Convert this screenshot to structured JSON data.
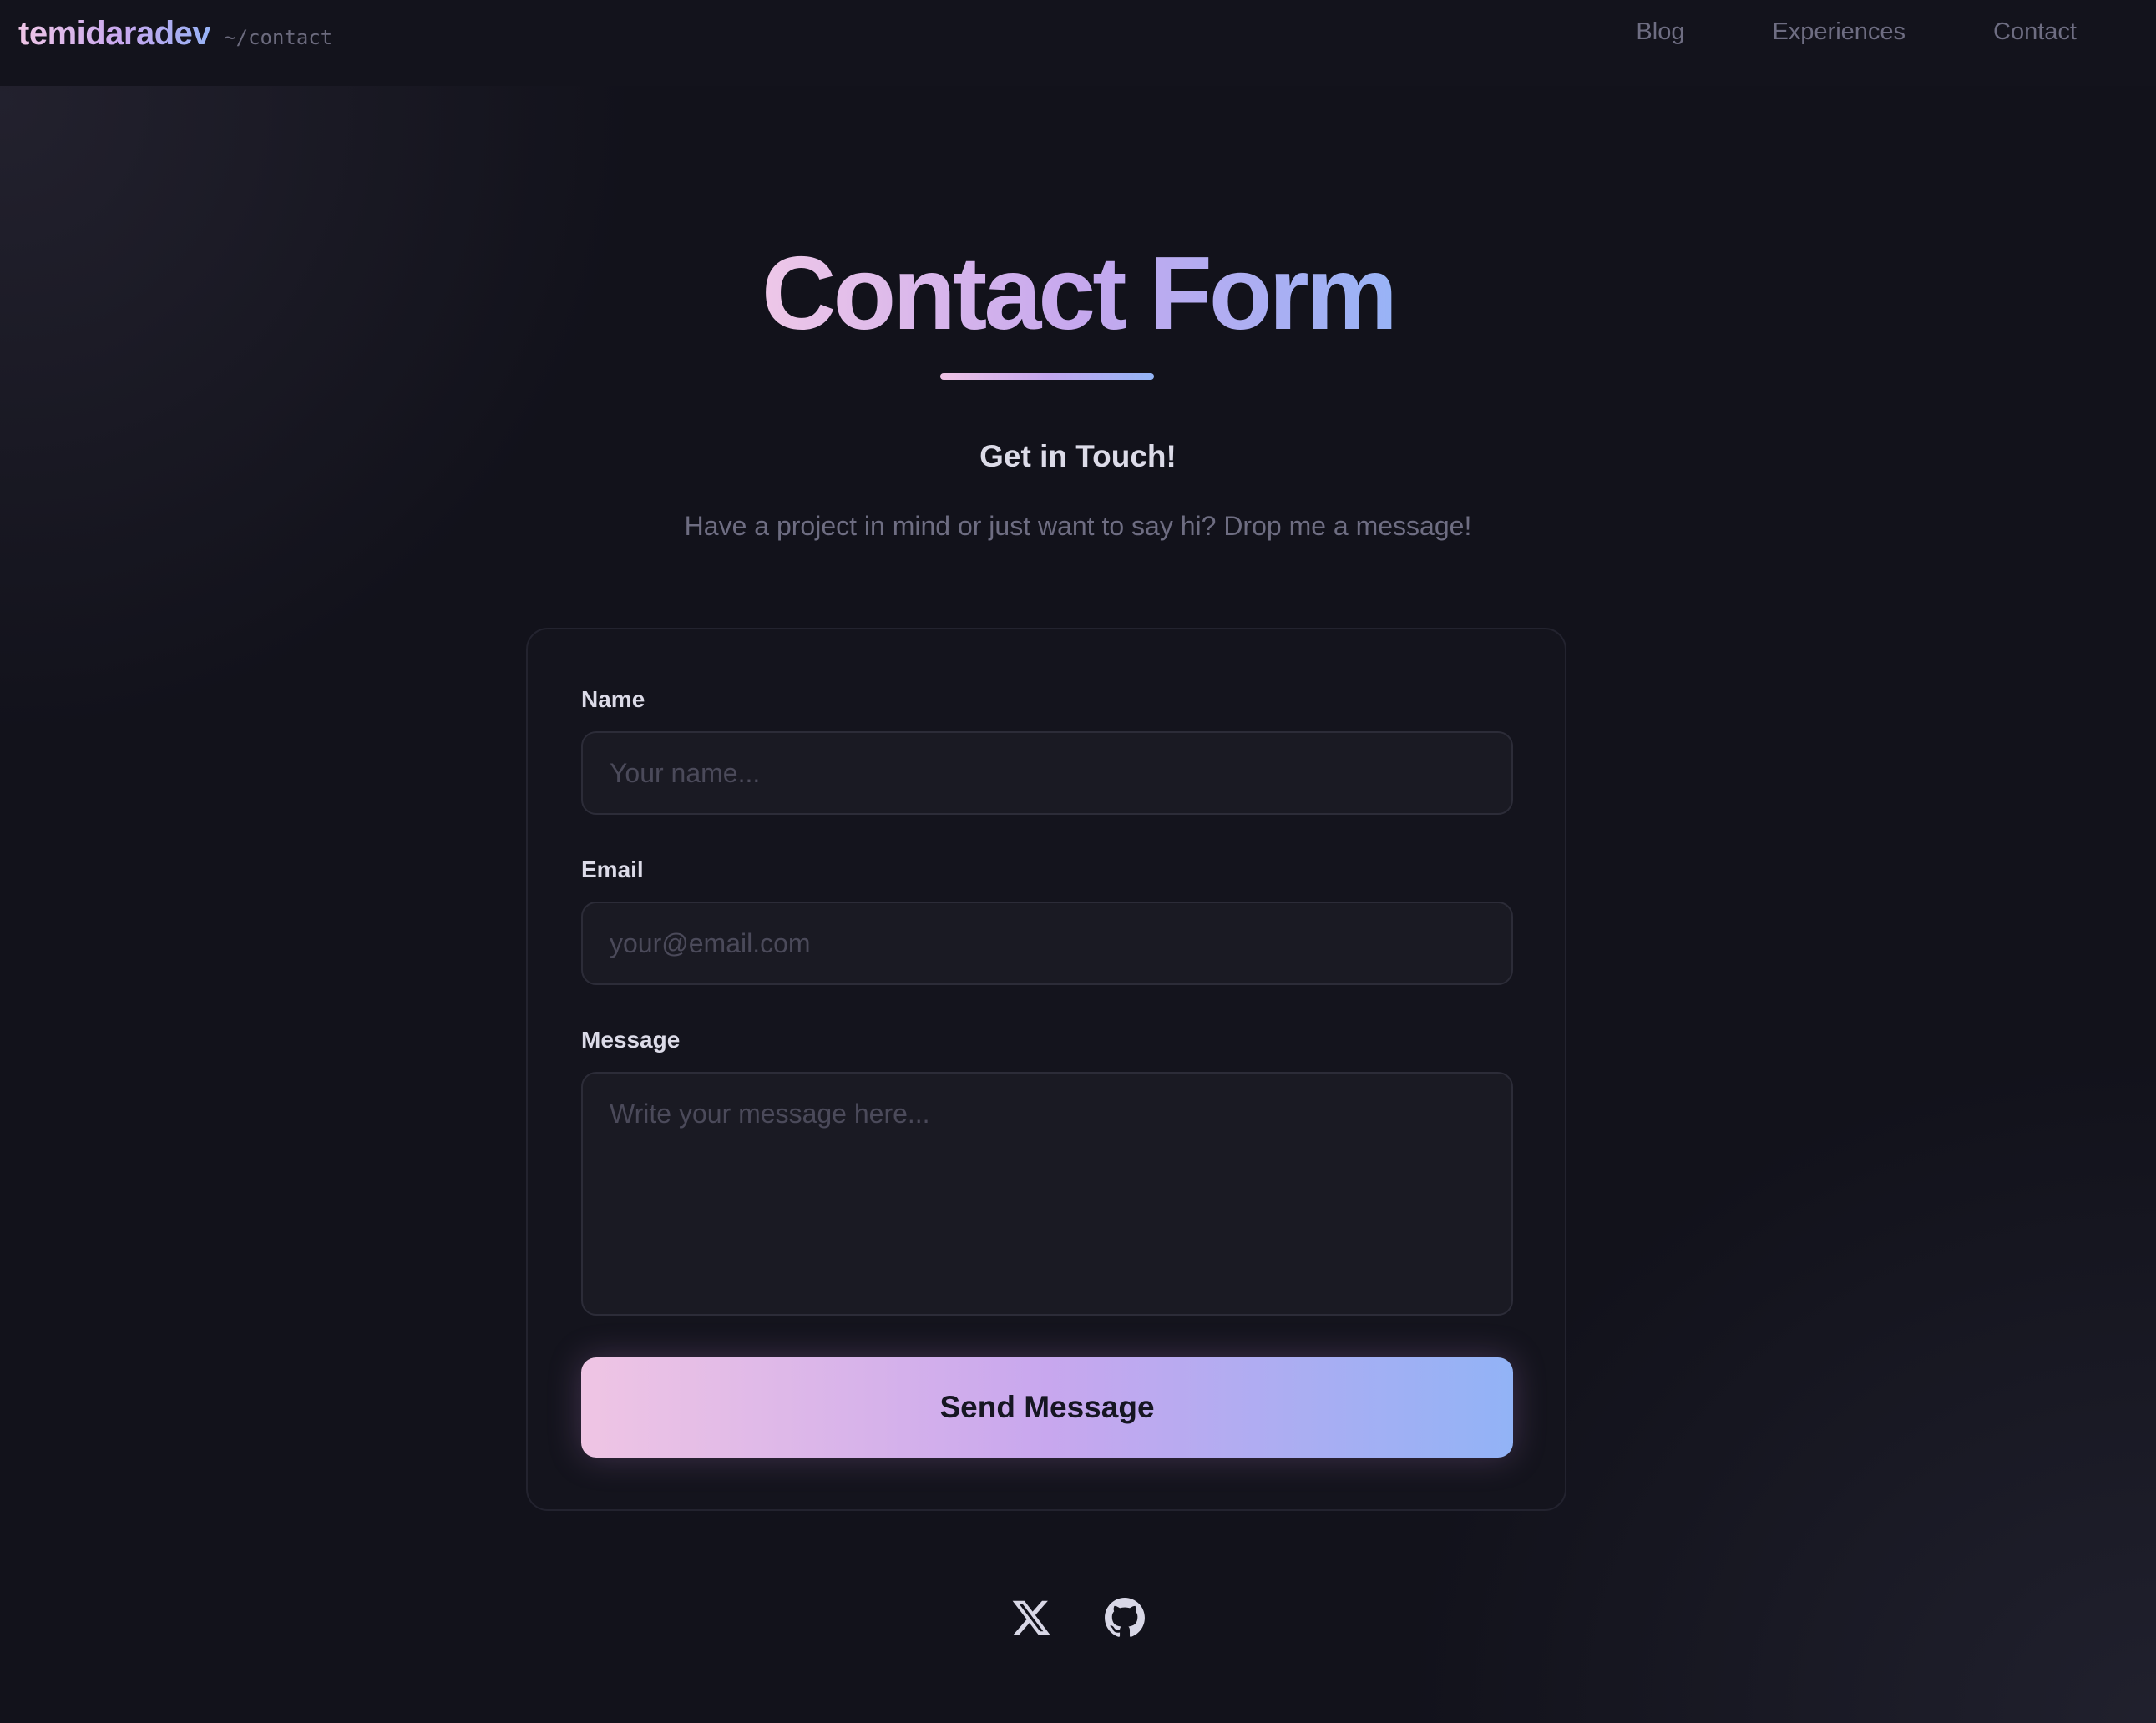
{
  "header": {
    "brand": "temidaradev",
    "path": "~/contact",
    "nav": [
      {
        "label": "Blog"
      },
      {
        "label": "Experiences"
      },
      {
        "label": "Contact"
      }
    ]
  },
  "main": {
    "title": "Contact Form",
    "subtitle": "Get in Touch!",
    "intro": "Have a project in mind or just want to say hi? Drop me a message!"
  },
  "form": {
    "name_label": "Name",
    "name_placeholder": "Your name...",
    "email_label": "Email",
    "email_placeholder": "your@email.com",
    "message_label": "Message",
    "message_placeholder": "Write your message here...",
    "submit_label": "Send Message"
  },
  "social": {
    "icons": [
      "x-twitter-icon",
      "github-icon"
    ]
  },
  "colors": {
    "background": "#12121b",
    "accent_pink": "#efc5e4",
    "accent_purple": "#c8a7ee",
    "accent_blue": "#92b3f6"
  }
}
